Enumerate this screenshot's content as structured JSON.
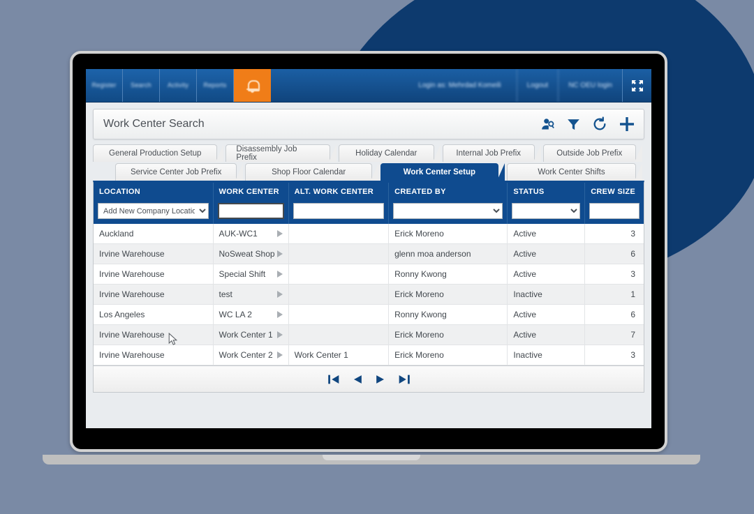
{
  "topnav": {
    "items": [
      {
        "label": "Register",
        "icon": "nav-icon-register"
      },
      {
        "label": "Search",
        "icon": "nav-icon-search"
      },
      {
        "label": "Activity",
        "icon": "nav-icon-activity"
      },
      {
        "label": "Reports",
        "icon": "nav-icon-reports"
      }
    ],
    "alert": {
      "label": "Alerts",
      "icon": "bell-icon"
    },
    "login_as": "Login as: Mehrdad Komeili",
    "logout": "Logout",
    "company": "NC OEU login",
    "fullscreen_icon": "fullscreen-icon",
    "accent_color": "#f07d18",
    "bar_color": "#1b5fa4"
  },
  "titlebar": {
    "title": "Work Center Search",
    "icons": [
      {
        "name": "user-search-icon"
      },
      {
        "name": "filter-icon"
      },
      {
        "name": "refresh-icon"
      },
      {
        "name": "add-icon"
      }
    ]
  },
  "tabs": {
    "row1": [
      {
        "label": "General Production Setup",
        "active": false
      },
      {
        "label": "Disassembly Job Prefix",
        "active": false
      },
      {
        "label": "Holiday Calendar",
        "active": false
      },
      {
        "label": "Internal Job Prefix",
        "active": false
      },
      {
        "label": "Outside Job Prefix",
        "active": false
      }
    ],
    "row2": [
      {
        "label": "Service Center Job Prefix",
        "active": false
      },
      {
        "label": "Shop Floor Calendar",
        "active": false
      },
      {
        "label": "Work Center Setup",
        "active": true
      },
      {
        "label": "Work Center Shifts",
        "active": false
      }
    ]
  },
  "table": {
    "headers": [
      "LOCATION",
      "WORK CENTER",
      "ALT. WORK CENTER",
      "CREATED BY",
      "STATUS",
      "CREW SIZE"
    ],
    "filters": {
      "location": "Add New Company Location",
      "work_center": "",
      "alt_work_center": "",
      "created_by": "",
      "status": "",
      "crew_size": ""
    },
    "rows": [
      {
        "location": "Auckland",
        "work_center": "AUK-WC1",
        "alt_work_center": "",
        "created_by": "Erick Moreno",
        "status": "Active",
        "crew_size": "3"
      },
      {
        "location": "Irvine Warehouse",
        "work_center": "NoSweat Shop",
        "alt_work_center": "",
        "created_by": "glenn moa anderson",
        "status": "Active",
        "crew_size": "6"
      },
      {
        "location": "Irvine Warehouse",
        "work_center": "Special Shift",
        "alt_work_center": "",
        "created_by": "Ronny Kwong",
        "status": "Active",
        "crew_size": "3"
      },
      {
        "location": "Irvine Warehouse",
        "work_center": "test",
        "alt_work_center": "",
        "created_by": "Erick Moreno",
        "status": "Inactive",
        "crew_size": "1"
      },
      {
        "location": "Los Angeles",
        "work_center": "WC LA 2",
        "alt_work_center": "",
        "created_by": "Ronny Kwong",
        "status": "Active",
        "crew_size": "6"
      },
      {
        "location": "Irvine Warehouse",
        "work_center": "Work Center 1",
        "alt_work_center": "",
        "created_by": "Erick Moreno",
        "status": "Active",
        "crew_size": "7"
      },
      {
        "location": "Irvine Warehouse",
        "work_center": "Work Center 2",
        "alt_work_center": "Work Center 1",
        "created_by": "Erick Moreno",
        "status": "Inactive",
        "crew_size": "3"
      }
    ]
  },
  "pager": {
    "buttons": [
      {
        "name": "first-page-button",
        "icon": "skip-back-icon"
      },
      {
        "name": "previous-page-button",
        "icon": "play-back-icon"
      },
      {
        "name": "next-page-button",
        "icon": "play-forward-icon"
      },
      {
        "name": "last-page-button",
        "icon": "skip-forward-icon"
      }
    ]
  },
  "theme": {
    "background": "#7a8aa5",
    "blob": "#0d3a6e",
    "header_blue": "#0f4b8f",
    "orange": "#f07d18"
  }
}
